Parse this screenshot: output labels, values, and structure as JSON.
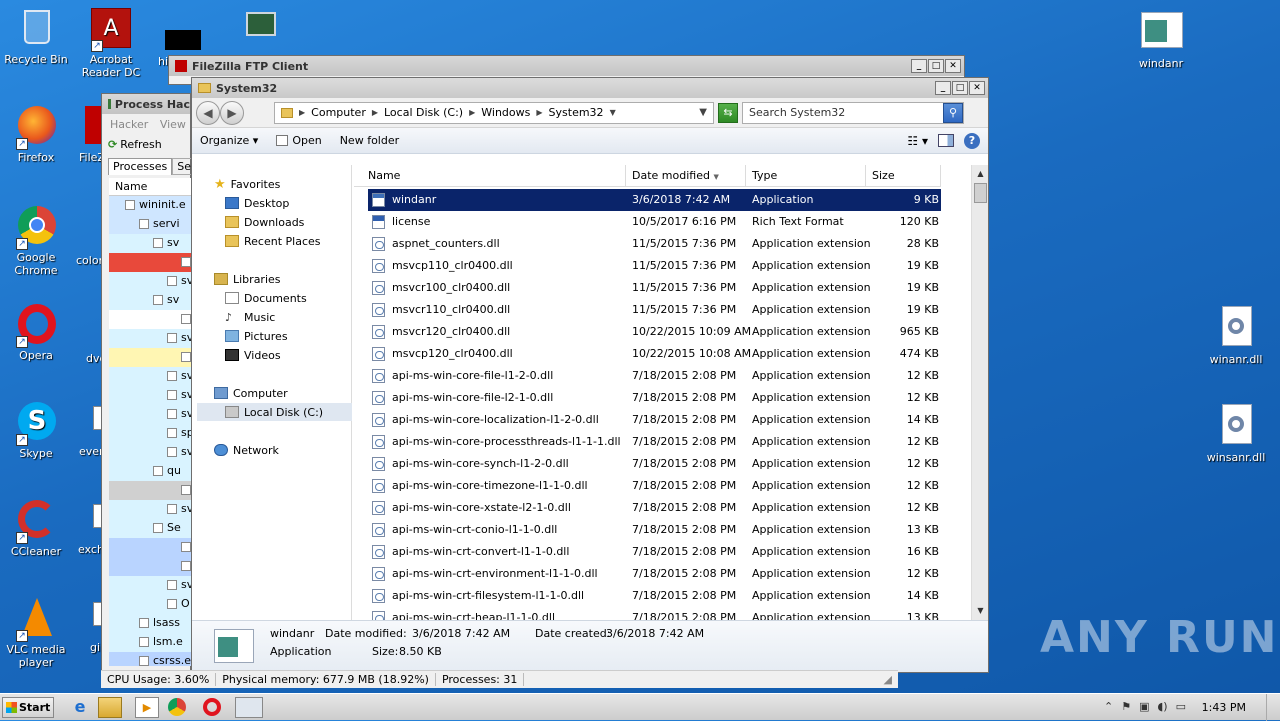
{
  "desktop_icons": [
    {
      "label": "Recycle Bin"
    },
    {
      "label": "Acrobat Reader DC"
    },
    {
      "label": "hi"
    },
    {
      "label": "Firefox"
    },
    {
      "label": "FileZ"
    },
    {
      "label": "Google Chrome"
    },
    {
      "label": "color"
    },
    {
      "label": "Opera"
    },
    {
      "label": "dvd"
    },
    {
      "label": "Skype"
    },
    {
      "label": "ever"
    },
    {
      "label": "CCleaner"
    },
    {
      "label": "exch"
    },
    {
      "label": "VLC media player"
    },
    {
      "label": "gir"
    },
    {
      "label": "windanr"
    },
    {
      "label": "winanr.dll"
    },
    {
      "label": "winsanr.dll"
    }
  ],
  "filezilla": {
    "title": "FileZilla FTP Client"
  },
  "process_hacker": {
    "title": "Process Hac",
    "menu": [
      "Hacker",
      "View"
    ],
    "refresh_label": "Refresh",
    "tabs": [
      "Processes",
      "Ser"
    ],
    "column_name": "Name",
    "rows": [
      "wininit.e",
      "servi",
      "sv",
      "",
      "sv",
      "sv",
      "",
      "sv",
      "",
      "sv",
      "sv",
      "sv",
      "sp",
      "sv",
      "qu",
      "",
      "sv",
      "Se",
      "",
      "",
      "sv",
      "O",
      "lsass",
      "lsm.e",
      "csrss.ex"
    ],
    "status": {
      "cpu": "CPU Usage: 3.60%",
      "memory": "Physical memory: 677.9 MB (18.92%)",
      "processes": "Processes: 31"
    }
  },
  "explorer": {
    "title": "System32",
    "breadcrumb": [
      "Computer",
      "Local Disk (C:)",
      "Windows",
      "System32"
    ],
    "search_placeholder": "Search System32",
    "toolbar": {
      "organize": "Organize",
      "open": "Open",
      "new_folder": "New folder"
    },
    "nav": {
      "favorites": "Favorites",
      "desktop": "Desktop",
      "downloads": "Downloads",
      "recent": "Recent Places",
      "libraries": "Libraries",
      "documents": "Documents",
      "music": "Music",
      "pictures": "Pictures",
      "videos": "Videos",
      "computer": "Computer",
      "local_disk": "Local Disk (C:)",
      "network": "Network"
    },
    "columns": {
      "name": "Name",
      "date": "Date modified",
      "type": "Type",
      "size": "Size"
    },
    "files": [
      {
        "name": "windanr",
        "date": "3/6/2018 7:42 AM",
        "type": "Application",
        "size": "9 KB",
        "kind": "app"
      },
      {
        "name": "license",
        "date": "10/5/2017 6:16 PM",
        "type": "Rich Text Format",
        "size": "120 KB",
        "kind": "rtf"
      },
      {
        "name": "aspnet_counters.dll",
        "date": "11/5/2015 7:36 PM",
        "type": "Application extension",
        "size": "28 KB",
        "kind": "dll"
      },
      {
        "name": "msvcp110_clr0400.dll",
        "date": "11/5/2015 7:36 PM",
        "type": "Application extension",
        "size": "19 KB",
        "kind": "dll"
      },
      {
        "name": "msvcr100_clr0400.dll",
        "date": "11/5/2015 7:36 PM",
        "type": "Application extension",
        "size": "19 KB",
        "kind": "dll"
      },
      {
        "name": "msvcr110_clr0400.dll",
        "date": "11/5/2015 7:36 PM",
        "type": "Application extension",
        "size": "19 KB",
        "kind": "dll"
      },
      {
        "name": "msvcr120_clr0400.dll",
        "date": "10/22/2015 10:09 AM",
        "type": "Application extension",
        "size": "965 KB",
        "kind": "dll"
      },
      {
        "name": "msvcp120_clr0400.dll",
        "date": "10/22/2015 10:08 AM",
        "type": "Application extension",
        "size": "474 KB",
        "kind": "dll"
      },
      {
        "name": "api-ms-win-core-file-l1-2-0.dll",
        "date": "7/18/2015 2:08 PM",
        "type": "Application extension",
        "size": "12 KB",
        "kind": "dll"
      },
      {
        "name": "api-ms-win-core-file-l2-1-0.dll",
        "date": "7/18/2015 2:08 PM",
        "type": "Application extension",
        "size": "12 KB",
        "kind": "dll"
      },
      {
        "name": "api-ms-win-core-localization-l1-2-0.dll",
        "date": "7/18/2015 2:08 PM",
        "type": "Application extension",
        "size": "14 KB",
        "kind": "dll"
      },
      {
        "name": "api-ms-win-core-processthreads-l1-1-1.dll",
        "date": "7/18/2015 2:08 PM",
        "type": "Application extension",
        "size": "12 KB",
        "kind": "dll"
      },
      {
        "name": "api-ms-win-core-synch-l1-2-0.dll",
        "date": "7/18/2015 2:08 PM",
        "type": "Application extension",
        "size": "12 KB",
        "kind": "dll"
      },
      {
        "name": "api-ms-win-core-timezone-l1-1-0.dll",
        "date": "7/18/2015 2:08 PM",
        "type": "Application extension",
        "size": "12 KB",
        "kind": "dll"
      },
      {
        "name": "api-ms-win-core-xstate-l2-1-0.dll",
        "date": "7/18/2015 2:08 PM",
        "type": "Application extension",
        "size": "12 KB",
        "kind": "dll"
      },
      {
        "name": "api-ms-win-crt-conio-l1-1-0.dll",
        "date": "7/18/2015 2:08 PM",
        "type": "Application extension",
        "size": "13 KB",
        "kind": "dll"
      },
      {
        "name": "api-ms-win-crt-convert-l1-1-0.dll",
        "date": "7/18/2015 2:08 PM",
        "type": "Application extension",
        "size": "16 KB",
        "kind": "dll"
      },
      {
        "name": "api-ms-win-crt-environment-l1-1-0.dll",
        "date": "7/18/2015 2:08 PM",
        "type": "Application extension",
        "size": "12 KB",
        "kind": "dll"
      },
      {
        "name": "api-ms-win-crt-filesystem-l1-1-0.dll",
        "date": "7/18/2015 2:08 PM",
        "type": "Application extension",
        "size": "14 KB",
        "kind": "dll"
      },
      {
        "name": "api-ms-win-crt-heap-l1-1-0.dll",
        "date": "7/18/2015 2:08 PM",
        "type": "Application extension",
        "size": "13 KB",
        "kind": "dll"
      }
    ],
    "details": {
      "name": "windanr",
      "kind": "Application",
      "modified_label": "Date modified:",
      "modified": "3/6/2018 7:42 AM",
      "created_label": "Date created:",
      "created": "3/6/2018 7:42 AM",
      "size_label": "Size:",
      "size": "8.50 KB"
    }
  },
  "taskbar": {
    "start": "Start",
    "clock": "1:43 PM"
  },
  "watermark": "ANY RUN"
}
